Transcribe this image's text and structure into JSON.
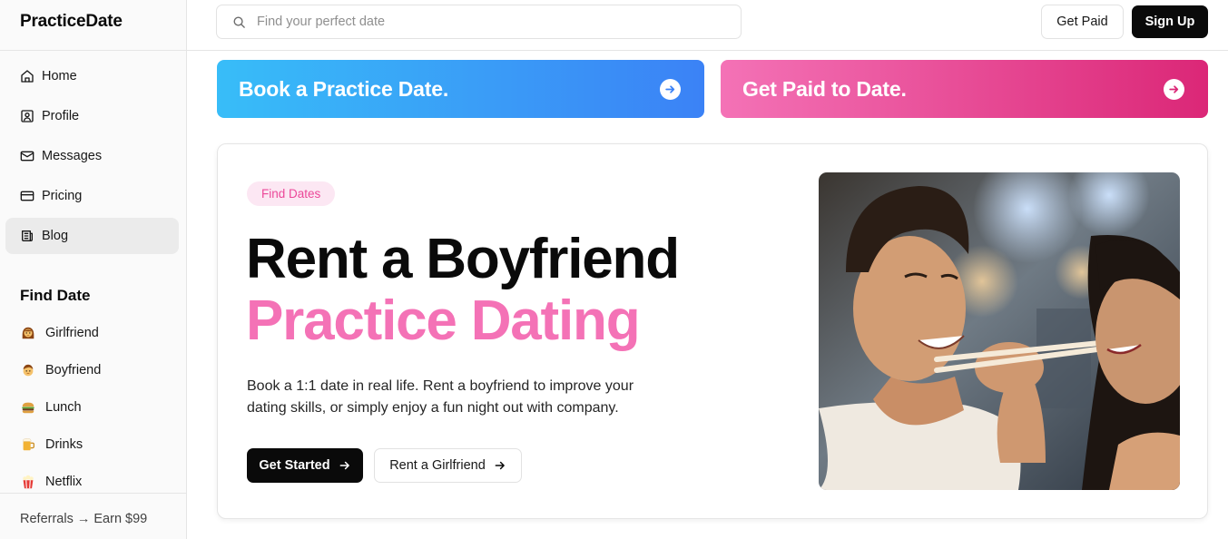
{
  "brand": "PracticeDate",
  "nav": {
    "items": [
      {
        "label": "Home",
        "icon": "home-icon"
      },
      {
        "label": "Profile",
        "icon": "profile-icon"
      },
      {
        "label": "Messages",
        "icon": "mail-icon"
      },
      {
        "label": "Pricing",
        "icon": "card-icon"
      },
      {
        "label": "Blog",
        "icon": "newspaper-icon",
        "active": true
      }
    ]
  },
  "find_date": {
    "title": "Find Date",
    "items": [
      {
        "label": "Girlfriend",
        "icon": "woman-emoji-icon"
      },
      {
        "label": "Boyfriend",
        "icon": "boy-emoji-icon"
      },
      {
        "label": "Lunch",
        "icon": "burger-emoji-icon"
      },
      {
        "label": "Drinks",
        "icon": "beer-emoji-icon"
      },
      {
        "label": "Netflix",
        "icon": "popcorn-emoji-icon"
      }
    ]
  },
  "referrals": "Referrals → Earn $99",
  "search": {
    "placeholder": "Find your perfect date",
    "value": ""
  },
  "header": {
    "get_paid": "Get Paid",
    "sign_up": "Sign Up"
  },
  "banners": {
    "book": "Book a Practice Date.",
    "paid": "Get Paid to Date."
  },
  "hero": {
    "badge": "Find Dates",
    "title_line1": "Rent a Boyfriend",
    "title_line2": "Practice Dating",
    "description": "Book a 1:1 date in real life. Rent a boyfriend to improve your dating skills, or simply enjoy a fun night out with company.",
    "cta_primary": "Get Started",
    "cta_secondary": "Rent a Girlfriend",
    "image": "couple-sharing-food-photo"
  },
  "colors": {
    "accent_pink": "#f472b6",
    "banner_blue_start": "#38bdf8",
    "banner_blue_end": "#3b82f6",
    "banner_pink_start": "#f472b6",
    "banner_pink_end": "#db2777",
    "primary_black": "#0a0a0a"
  }
}
